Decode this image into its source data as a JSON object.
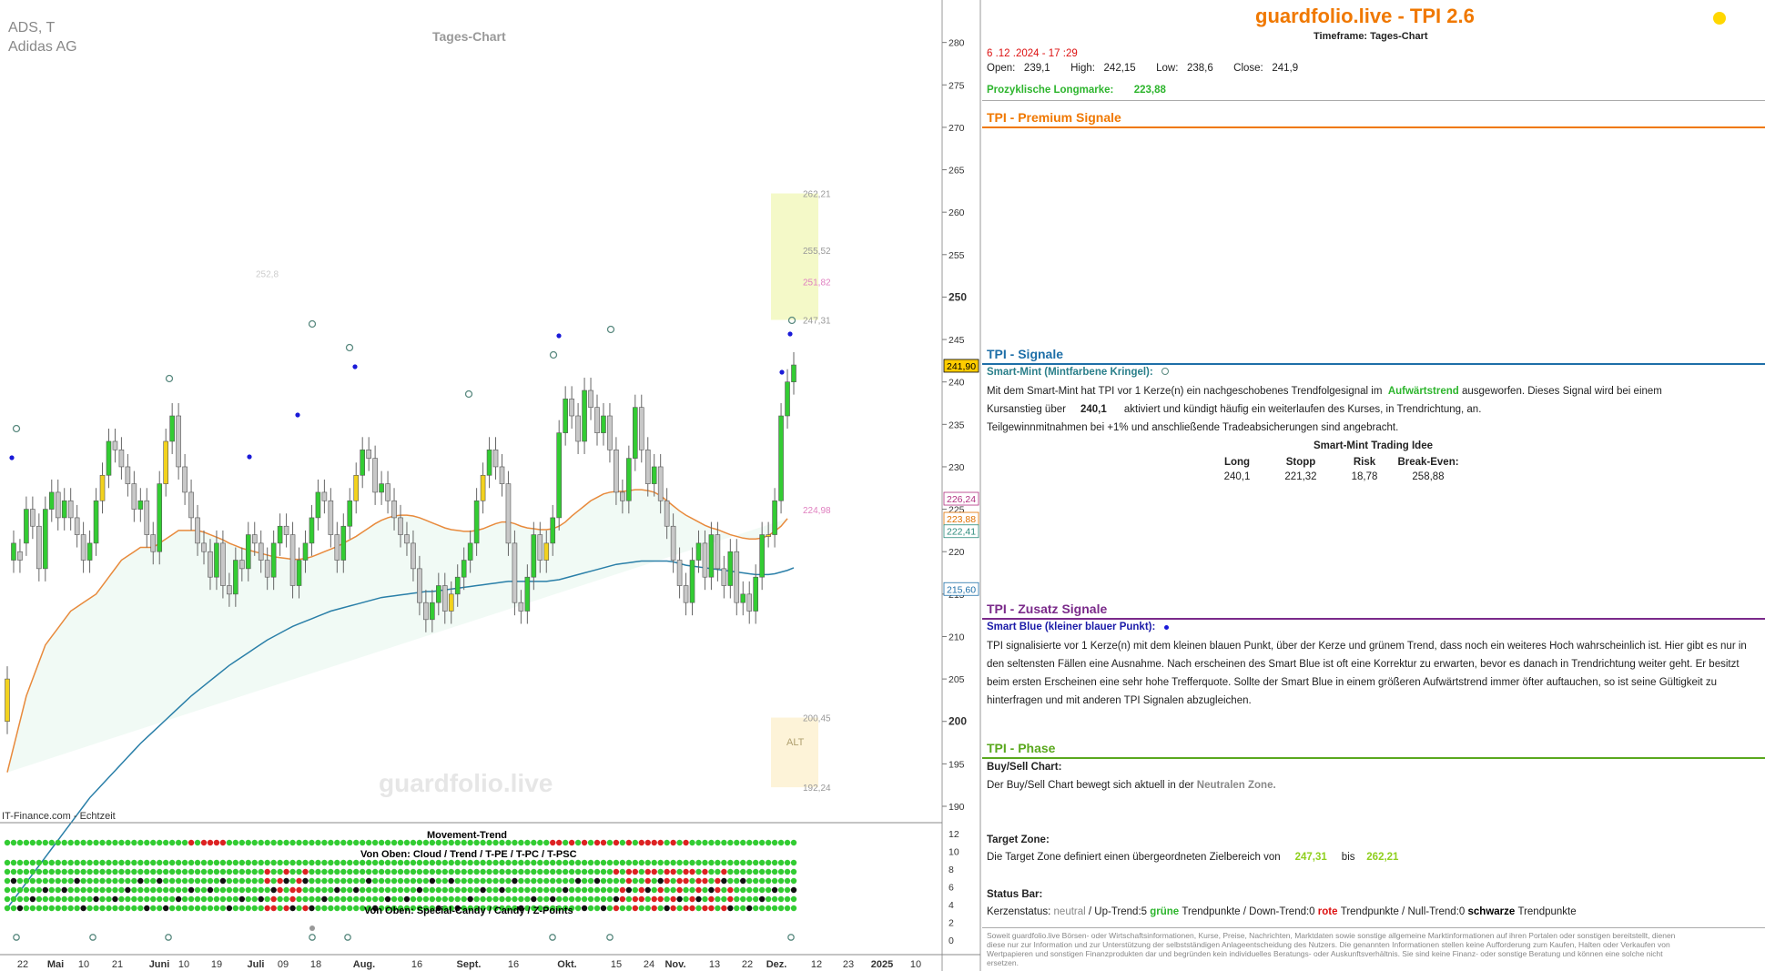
{
  "chart": {
    "symbol": "ADS, T",
    "name": "Adidas AG",
    "title": "Tages-Chart",
    "watermark": "guardfolio.live",
    "source": "IT-Finance.com - Echtzeit",
    "price_labels": {
      "current": "241,90",
      "l1": "226,24",
      "l2": "223,88",
      "l3": "222,41",
      "l4": "215,60"
    },
    "zone_labels": [
      "262,21",
      "255,52",
      "251,82",
      "247,31",
      "200,45",
      "192,24",
      "224,98",
      "252,8"
    ],
    "alt_label": "ALT",
    "indicator_title": "Movement-Trend",
    "indicator_sub1": "Von Oben: Cloud / Trend / T-PE / T-PC / T-PSC",
    "indicator_sub2": "Von Oben: Special-Candy / Candy / Z-Points",
    "y_ticks_ind": [
      "12",
      "10",
      "8",
      "6",
      "4",
      "2",
      "0"
    ],
    "x_ticks": [
      "22",
      "Mai",
      "10",
      "21",
      "Juni",
      "10",
      "19",
      "Juli",
      "09",
      "18",
      "Aug.",
      "16",
      "Sept.",
      "16",
      "Okt.",
      "15",
      "24",
      "Nov.",
      "13",
      "22",
      "Dez.",
      "12",
      "23",
      "2025",
      "10"
    ]
  },
  "chart_data": {
    "type": "candlestick",
    "ylim": [
      190,
      282
    ],
    "y_ticks": [
      190,
      195,
      200,
      205,
      210,
      215,
      220,
      225,
      230,
      235,
      240,
      245,
      250,
      255,
      260,
      265,
      270,
      275,
      280
    ],
    "close": [
      205,
      221,
      219,
      225,
      223,
      218,
      225,
      227,
      224,
      226,
      224,
      222,
      219,
      221,
      226,
      229,
      233,
      232,
      230,
      228,
      225,
      226,
      222,
      220,
      228,
      233,
      236,
      230,
      227,
      224,
      221,
      220,
      217,
      221,
      216,
      215,
      219,
      218,
      222,
      221,
      219,
      217,
      221,
      223,
      222,
      216,
      219,
      221,
      224,
      227,
      226,
      222,
      219,
      223,
      226,
      229,
      232,
      231,
      227,
      228,
      226,
      224,
      222,
      221,
      218,
      214,
      212,
      214,
      216,
      213,
      215,
      217,
      219,
      221,
      226,
      229,
      232,
      230,
      228,
      221,
      214,
      213,
      217,
      222,
      219,
      221,
      224,
      234,
      238,
      236,
      233,
      239,
      237,
      234,
      236,
      232,
      227,
      226,
      231,
      237,
      232,
      228,
      230,
      226,
      223,
      219,
      216,
      214,
      219,
      221,
      217,
      222,
      218,
      216,
      220,
      214,
      215,
      213,
      217,
      222,
      222,
      226,
      236,
      240,
      242
    ],
    "open": [
      200,
      219,
      220,
      221,
      225,
      223,
      218,
      225,
      227,
      224,
      226,
      224,
      222,
      219,
      221,
      226,
      229,
      233,
      232,
      230,
      228,
      225,
      226,
      222,
      220,
      228,
      233,
      236,
      230,
      227,
      224,
      221,
      220,
      217,
      221,
      216,
      215,
      219,
      218,
      222,
      221,
      219,
      217,
      221,
      223,
      222,
      216,
      219,
      221,
      224,
      227,
      226,
      222,
      219,
      223,
      226,
      229,
      232,
      231,
      227,
      228,
      226,
      224,
      222,
      221,
      218,
      214,
      212,
      214,
      216,
      213,
      215,
      217,
      219,
      221,
      226,
      229,
      232,
      230,
      228,
      221,
      214,
      213,
      217,
      222,
      219,
      221,
      224,
      234,
      238,
      236,
      233,
      239,
      237,
      234,
      236,
      232,
      227,
      226,
      231,
      237,
      232,
      228,
      230,
      226,
      223,
      219,
      216,
      214,
      219,
      221,
      217,
      222,
      218,
      216,
      220,
      214,
      215,
      213,
      217,
      222,
      222,
      226,
      236,
      240
    ],
    "ema_orange": [
      194,
      197,
      200,
      203,
      205,
      207,
      209,
      210,
      211,
      212,
      213,
      213.5,
      214,
      214.5,
      215,
      216,
      217,
      218,
      219,
      219.5,
      220,
      220.5,
      220.5,
      220.5,
      221,
      221.5,
      222,
      222.5,
      222.5,
      222.5,
      222.5,
      222.3,
      222,
      221.7,
      221.4,
      221,
      220.7,
      220.4,
      220.2,
      220,
      219.8,
      219.6,
      219.4,
      219.3,
      219.2,
      219.1,
      219.1,
      219.2,
      219.4,
      219.7,
      220,
      220.3,
      220.6,
      221,
      221.4,
      221.8,
      222.3,
      222.8,
      223.3,
      223.7,
      224,
      224.2,
      224.3,
      224.3,
      224.2,
      224,
      223.7,
      223.4,
      223.1,
      222.8,
      222.6,
      222.5,
      222.4,
      222.4,
      222.5,
      222.7,
      223,
      223.3,
      223.5,
      223.5,
      223.3,
      223,
      222.8,
      222.7,
      222.6,
      222.6,
      222.7,
      223,
      223.5,
      224.2,
      224.8,
      225.4,
      226,
      226.4,
      226.8,
      227,
      227.1,
      227.1,
      227.2,
      227.3,
      227.3,
      227.2,
      227,
      226.6,
      226,
      225.4,
      224.8,
      224.3,
      223.9,
      223.5,
      223.1,
      222.8,
      222.6,
      222.3,
      222,
      221.8,
      221.6,
      221.5,
      221.5,
      221.6,
      221.9,
      222.4,
      223,
      223.9
    ],
    "ema_blue": [
      178,
      179,
      180,
      181,
      182,
      183,
      184,
      185,
      186,
      187,
      188,
      189,
      190,
      191,
      191.8,
      192.6,
      193.4,
      194.2,
      195,
      195.8,
      196.6,
      197.4,
      198.1,
      198.8,
      199.5,
      200.2,
      200.9,
      201.6,
      202.3,
      203,
      203.6,
      204.2,
      204.8,
      205.4,
      206,
      206.6,
      207.1,
      207.6,
      208.1,
      208.6,
      209.1,
      209.6,
      210,
      210.4,
      210.8,
      211.2,
      211.5,
      211.8,
      212.1,
      212.4,
      212.7,
      213,
      213.2,
      213.4,
      213.6,
      213.8,
      214,
      214.2,
      214.4,
      214.6,
      214.7,
      214.8,
      214.9,
      215,
      215.1,
      215.2,
      215.3,
      215.3,
      215.4,
      215.5,
      215.6,
      215.7,
      215.8,
      215.9,
      216,
      216.1,
      216.2,
      216.3,
      216.4,
      216.5,
      216.5,
      216.5,
      216.5,
      216.5,
      216.5,
      216.5,
      216.6,
      216.7,
      216.9,
      217.1,
      217.3,
      217.5,
      217.7,
      217.9,
      218.1,
      218.3,
      218.5,
      218.6,
      218.7,
      218.8,
      218.9,
      218.9,
      218.9,
      218.9,
      218.9,
      218.8,
      218.6,
      218.4,
      218.3,
      218.2,
      218.1,
      218,
      217.9,
      217.8,
      217.7,
      217.6,
      217.5,
      217.4,
      217.3,
      217.3,
      217.3,
      217.4,
      217.6,
      217.8,
      218.1
    ],
    "zones": [
      {
        "label": "target",
        "from": 247.31,
        "to": 262.21
      },
      {
        "label": "ALT",
        "from": 192.24,
        "to": 200.45
      }
    ],
    "movement_trend_rows": 7
  },
  "panel": {
    "title": "guardfolio.live - TPI 2.6",
    "timeframe": "Timeframe: Tages-Chart",
    "date": "6 .12 .2024  - 17 :29",
    "open_label": "Open:",
    "open": "239,1",
    "high_label": "High:",
    "high": "242,15",
    "low_label": "Low:",
    "low": "238,6",
    "close_label": "Close:",
    "close": "241,9",
    "prozyk_label": "Prozyklische Longmarke:",
    "prozyk": "223,88",
    "premium_title": "TPI - Premium Signale",
    "signale_title": "TPI - Signale",
    "smartmint_label": "Smart-Mint (Mintfarbene Kringel):",
    "smartmint_text1": "Mit dem Smart-Mint hat TPI vor 1  Kerze(n) ein nachgeschobenes Trendfolgesignal im",
    "smartmint_trend": "Aufwärtstrend",
    "smartmint_text2": "ausgeworfen. Dieses Signal wird bei einem",
    "smartmint_text3": "Kursanstieg über",
    "smartmint_level": "240,1",
    "smartmint_text4": "aktiviert und kündigt häufig ein weiterlaufen des Kurses, in Trendrichtung, an.",
    "smartmint_text5": "Teilgewinnmitnahmen bei +1% und anschließende Tradeabsicherungen sind angebracht.",
    "idea_title": "Smart-Mint Trading Idee",
    "idea_heads": [
      "Long",
      "Stopp",
      "Risk",
      "Break-Even:"
    ],
    "idea_vals": [
      "240,1",
      "221,32",
      "18,78",
      "258,88"
    ],
    "zusatz_title": "TPI - Zusatz Signale",
    "smartblue_label": "Smart Blue (kleiner blauer Punkt):",
    "smartblue_text": "TPI signalisierte vor 1  Kerze(n) mit dem kleinen blauen Punkt, über der Kerze und grünem Trend, dass noch ein weiteres Hoch wahrscheinlich ist. Hier gibt es nur in den seltensten Fällen eine Ausnahme. Nach erscheinen des Smart Blue ist oft eine Korrektur zu erwarten, bevor es danach in Trendrichtung weiter geht. Er besitzt beim ersten Erscheinen eine sehr hohe Trefferquote. Sollte der Smart Blue in einem größeren Aufwärtstrend immer öfter auftauchen, so ist seine Gültigkeit zu hinterfragen und mit anderen TPI Signalen abzugleichen.",
    "phase_title": "TPI - Phase",
    "buysell_label": "Buy/Sell Chart:",
    "buysell_text": "Der Buy/Sell Chart bewegt sich aktuell in der",
    "buysell_zone": "Neutralen Zone.",
    "target_label": "Target Zone:",
    "target_text": "Die Target Zone definiert einen übergeordneten Zielbereich von",
    "target_from": "247,31",
    "target_bis": "bis",
    "target_to": "262,21",
    "status_label": "Status Bar:",
    "status_k": "Kerzenstatus:",
    "status_neutral": "neutral",
    "status_up": "/ Up-Trend:5",
    "status_gruene": "grüne",
    "status_tp1": "Trendpunkte  / Down-Trend:0",
    "status_rote": "rote",
    "status_tp2": "Trendpunkte / Null-Trend:0",
    "status_schwarze": "schwarze",
    "status_tp3": "Trendpunkte",
    "disclaimer": "Soweit guardfolio.live Börsen- oder Wirtschaftsinformationen, Kurse, Preise, Nachrichten, Marktdaten sowie sonstige allgemeine Marktinformationen auf ihren Portalen oder sonstigen bereitstellt, dienen diese nur zur Information und zur Unterstützung der selbstständigen Anlageentscheidung des Nutzers. Die genannten Informationen stellen keine Aufforderung zum Kaufen, Halten oder Verkaufen von Wertpapieren und sonstigen Finanzprodukten dar und begründen kein individuelles Beratungs- oder Auskunftsverhältnis. Sie sind keine Finanz- oder sonstige Beratung und können eine solche nicht ersetzen.",
    "colors": {
      "orange": "#f07800",
      "blue": "#1e6fa8",
      "purple": "#7a2a8a",
      "green": "#5aa81e",
      "yellow": "#ffd700"
    }
  }
}
